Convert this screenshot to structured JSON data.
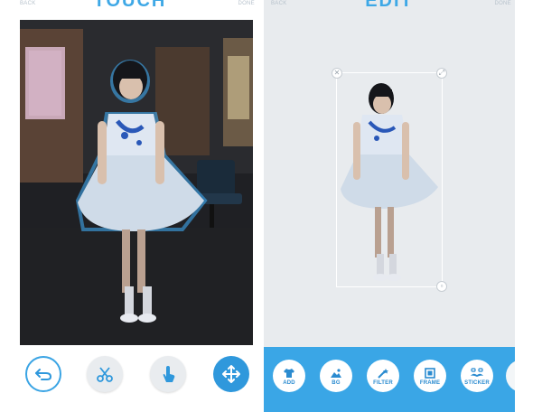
{
  "left_screen": {
    "back_label": "BACK",
    "done_label": "DONE",
    "title": "TOUCH",
    "tools": [
      {
        "name": "undo",
        "icon": "undo-arrow-icon"
      },
      {
        "name": "cut",
        "icon": "scissors-icon"
      },
      {
        "name": "touch",
        "icon": "hand-touch-icon"
      },
      {
        "name": "move",
        "icon": "move-arrows-icon"
      }
    ]
  },
  "right_screen": {
    "back_label": "BACK",
    "done_label": "DONE",
    "title": "EDIT",
    "toolbar": [
      {
        "label": "ADD",
        "icon": "add-shirt-icon"
      },
      {
        "label": "BG",
        "icon": "background-image-icon"
      },
      {
        "label": "FILTER",
        "icon": "magic-wand-icon"
      },
      {
        "label": "FRAME",
        "icon": "frame-icon"
      },
      {
        "label": "STICKER",
        "icon": "sticker-mustache-icon"
      },
      {
        "label": "",
        "icon": "more-icon"
      }
    ]
  },
  "colors": {
    "accent": "#3aa6e6",
    "outline_glow": "#3aa4e4",
    "edit_bg": "#e8ebee"
  }
}
